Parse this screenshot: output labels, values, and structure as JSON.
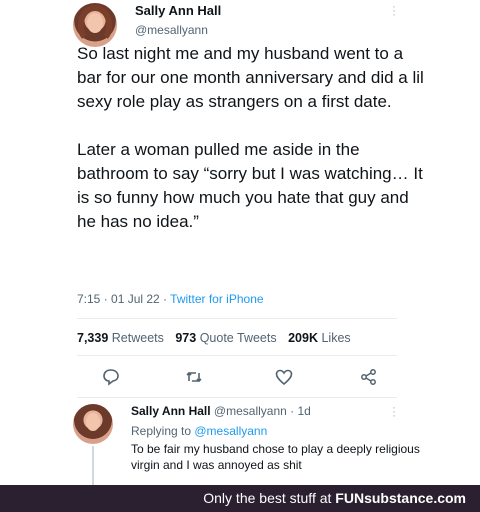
{
  "tweet": {
    "name": "Sally Ann Hall",
    "handle": "@mesallyann",
    "body": "So last night me and my husband went to a bar for our one month anniversary and did a lil sexy role play as strangers on a first date.\n\nLater a woman pulled me aside in the bathroom to say “sorry but I was watching… It is so funny how much you hate that guy and he has no idea.”",
    "time": "7:15 · 01 Jul 22 · ",
    "source": "Twitter for iPhone",
    "retweets_count": "7,339",
    "retweets_label": "Retweets",
    "quotes_count": "973",
    "quotes_label": "Quote Tweets",
    "likes_count": "209K",
    "likes_label": "Likes",
    "icons": [
      "reply-icon",
      "retweet-icon",
      "like-icon",
      "share-icon"
    ]
  },
  "reply": {
    "name": "Sally Ann Hall",
    "handle_time": "@mesallyann · 1d",
    "replying_prefix": "Replying to ",
    "replying_to": "@mesallyann",
    "text": "To be fair my husband chose to play a deeply religious virgin and I was annoyed as shit"
  },
  "banner": {
    "prefix": "Only the best stuff at ",
    "brand": "FUNsubstance.com",
    "color": "#2b2030"
  }
}
